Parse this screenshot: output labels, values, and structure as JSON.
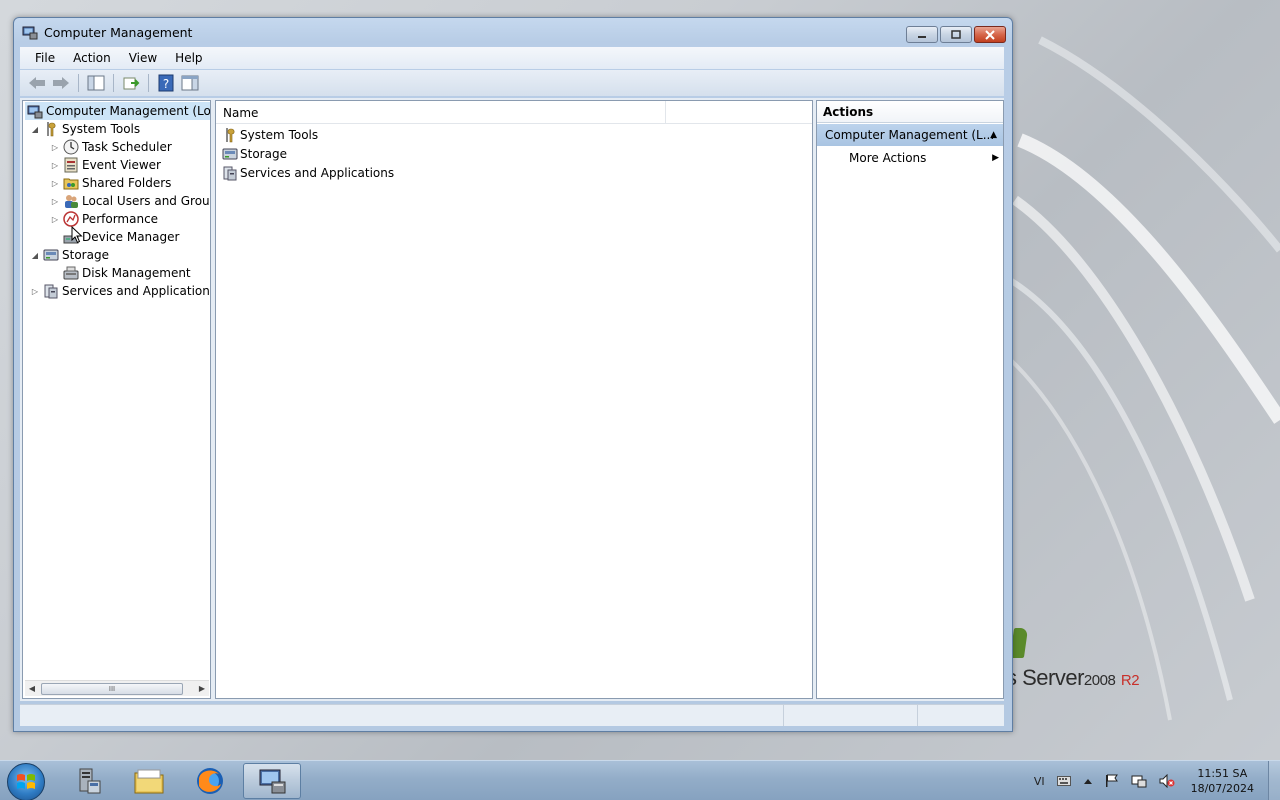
{
  "window": {
    "title": "Computer Management",
    "controls": {
      "minimize": "–",
      "maximize": "□",
      "close": "✕"
    }
  },
  "menu": [
    "File",
    "Action",
    "View",
    "Help"
  ],
  "toolbar": [
    "back-icon",
    "forward-icon",
    "show-hide-tree-icon",
    "export-list-icon",
    "help-icon",
    "show-hide-action-pane-icon"
  ],
  "tree": {
    "root": "Computer Management (Local",
    "system_tools": "System Tools",
    "task_scheduler": "Task Scheduler",
    "event_viewer": "Event Viewer",
    "shared_folders": "Shared Folders",
    "local_users": "Local Users and Groups",
    "performance": "Performance",
    "device_manager": "Device Manager",
    "storage": "Storage",
    "disk_management": "Disk Management",
    "services": "Services and Applications",
    "scroll_thumb": "III"
  },
  "list": {
    "column_name": "Name",
    "items": [
      "System Tools",
      "Storage",
      "Services and Applications"
    ]
  },
  "actions": {
    "header": "Actions",
    "section": "Computer Management (L...",
    "more": "More Actions"
  },
  "desktop": {
    "brand_main": "s Server",
    "brand_version": "2008",
    "brand_r2": "R2"
  },
  "taskbar": {
    "apps": [
      "server-manager-icon",
      "windows-explorer-icon",
      "firefox-icon",
      "computer-management-icon"
    ],
    "tray": {
      "lang": "VI",
      "time": "11:51 SA",
      "date": "18/07/2024"
    }
  },
  "colors": {
    "selection": "#cce4f7",
    "window_frame": "#b8cde6",
    "taskbar": "#93adc8"
  }
}
